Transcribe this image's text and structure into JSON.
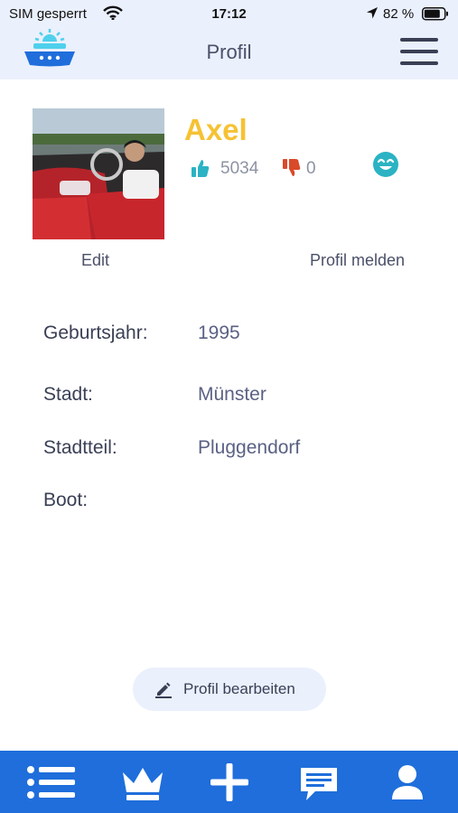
{
  "status_bar": {
    "carrier": "SIM gesperrt",
    "time": "17:12",
    "battery": "82 %"
  },
  "header": {
    "title": "Profil"
  },
  "profile": {
    "name": "Axel",
    "likes": "5034",
    "dislikes": "0",
    "edit_label": "Edit",
    "report_label": "Profil melden"
  },
  "info": {
    "birth_year_label": "Geburtsjahr:",
    "birth_year_value": "1995",
    "city_label": "Stadt:",
    "city_value": "Münster",
    "district_label": "Stadtteil:",
    "district_value": "Pluggendorf",
    "boat_label": "Boot:",
    "boat_value": ""
  },
  "actions": {
    "edit_profile_label": "Profil bearbeiten"
  },
  "tabbar": {
    "items": [
      "list-icon",
      "crown-icon",
      "plus-icon",
      "chat-icon",
      "user-icon"
    ]
  },
  "colors": {
    "accent": "#1f6edb",
    "name": "#f6c233",
    "header_bg": "#eaf0fc",
    "thumb_up": "#2bb3c4",
    "thumb_down": "#d94a2a"
  }
}
